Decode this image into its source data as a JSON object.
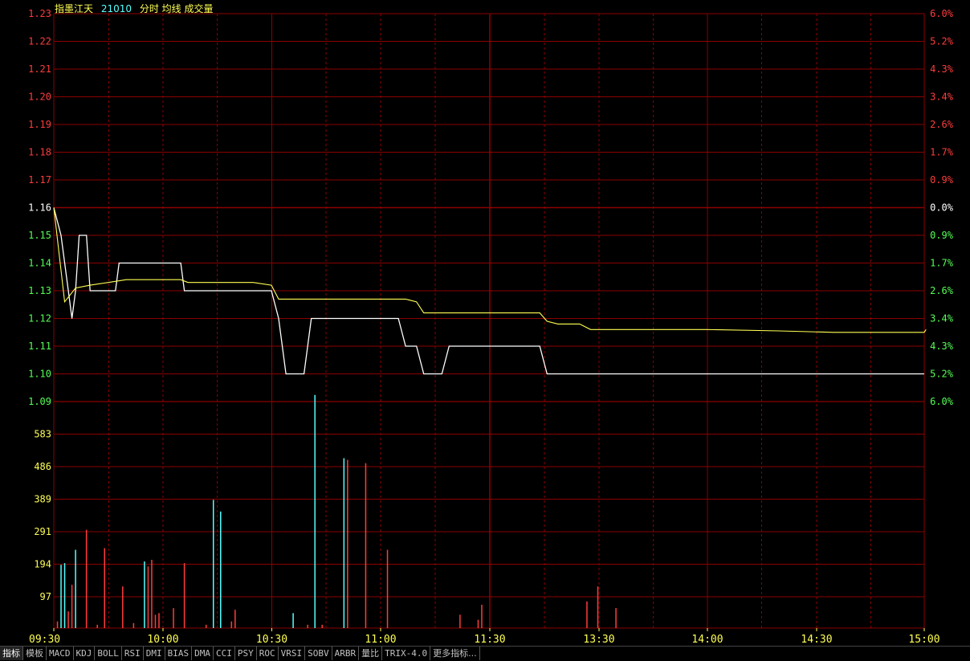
{
  "header": {
    "name": "指墨江天",
    "code": "21010",
    "legend": "分时 均线 成交量"
  },
  "colors": {
    "background": "#000000",
    "grid": "#8b0000",
    "axis_red": "#ff3c3c",
    "axis_green": "#54ff54",
    "axis_neutral": "#ffffff",
    "volume_axis": "#ffff54",
    "time_axis": "#ffff54",
    "price_line": "#ffffff",
    "avg_line": "#ffff54",
    "vol_up": "#ff3c3c",
    "vol_down": "#54ffff"
  },
  "chart_data": {
    "type": "line",
    "title": "指墨江天 21010",
    "x_ticks": [
      "09:30",
      "10:00",
      "10:30",
      "11:00",
      "11:30",
      "13:30",
      "14:00",
      "14:30",
      "15:00"
    ],
    "price_ticks": [
      "1.23",
      "1.22",
      "1.21",
      "1.20",
      "1.19",
      "1.18",
      "1.17",
      "1.16",
      "1.15",
      "1.14",
      "1.13",
      "1.12",
      "1.11",
      "1.10",
      "1.09"
    ],
    "pct_ticks": [
      "6.0%",
      "5.2%",
      "4.3%",
      "3.4%",
      "2.6%",
      "1.7%",
      "0.9%",
      "0.0%",
      "0.9%",
      "1.7%",
      "2.6%",
      "3.4%",
      "4.3%",
      "5.2%",
      "6.0%"
    ],
    "volume_ticks": [
      "583",
      "486",
      "389",
      "291",
      "194",
      "97"
    ],
    "price_range": [
      1.09,
      1.23
    ],
    "prev_close": 1.16,
    "volume_range": [
      0,
      680
    ],
    "minutes_total": 240,
    "series": [
      {
        "name": "分时",
        "points": [
          [
            0,
            1.16
          ],
          [
            2,
            1.15
          ],
          [
            4,
            1.13
          ],
          [
            5,
            1.12
          ],
          [
            6,
            1.13
          ],
          [
            7,
            1.15
          ],
          [
            9,
            1.15
          ],
          [
            10,
            1.13
          ],
          [
            17,
            1.13
          ],
          [
            18,
            1.14
          ],
          [
            35,
            1.14
          ],
          [
            36,
            1.13
          ],
          [
            60,
            1.13
          ],
          [
            62,
            1.12
          ],
          [
            64,
            1.1
          ],
          [
            69,
            1.1
          ],
          [
            71,
            1.12
          ],
          [
            95,
            1.12
          ],
          [
            97,
            1.11
          ],
          [
            100,
            1.11
          ],
          [
            102,
            1.1
          ],
          [
            107,
            1.1
          ],
          [
            109,
            1.11
          ],
          [
            134,
            1.11
          ],
          [
            136,
            1.1
          ],
          [
            240,
            1.1
          ]
        ]
      },
      {
        "name": "均线",
        "points": [
          [
            0,
            1.16
          ],
          [
            3,
            1.126
          ],
          [
            6,
            1.131
          ],
          [
            10,
            1.132
          ],
          [
            15,
            1.133
          ],
          [
            20,
            1.134
          ],
          [
            35,
            1.134
          ],
          [
            37,
            1.133
          ],
          [
            55,
            1.133
          ],
          [
            60,
            1.132
          ],
          [
            62,
            1.127
          ],
          [
            97,
            1.127
          ],
          [
            100,
            1.126
          ],
          [
            102,
            1.122
          ],
          [
            134,
            1.122
          ],
          [
            136,
            1.119
          ],
          [
            139,
            1.118
          ],
          [
            145,
            1.118
          ],
          [
            148,
            1.116
          ],
          [
            165,
            1.116
          ],
          [
            180,
            1.116
          ],
          [
            200,
            1.1155
          ],
          [
            215,
            1.115
          ],
          [
            240,
            1.115
          ],
          [
            240.5,
            1.116
          ]
        ]
      }
    ],
    "volume_bars": [
      [
        1,
        20,
        "up"
      ],
      [
        2,
        190,
        "down"
      ],
      [
        3,
        195,
        "down"
      ],
      [
        4,
        50,
        "up"
      ],
      [
        5,
        130,
        "up"
      ],
      [
        6,
        235,
        "down"
      ],
      [
        9,
        295,
        "up"
      ],
      [
        12,
        10,
        "up"
      ],
      [
        14,
        240,
        "up"
      ],
      [
        19,
        125,
        "up"
      ],
      [
        22,
        15,
        "up"
      ],
      [
        25,
        200,
        "down"
      ],
      [
        26,
        185,
        "up"
      ],
      [
        27,
        205,
        "up"
      ],
      [
        28,
        40,
        "up"
      ],
      [
        29,
        45,
        "up"
      ],
      [
        33,
        60,
        "up"
      ],
      [
        36,
        195,
        "up"
      ],
      [
        42,
        10,
        "up"
      ],
      [
        44,
        385,
        "down"
      ],
      [
        46,
        350,
        "down"
      ],
      [
        49,
        20,
        "up"
      ],
      [
        50,
        55,
        "up"
      ],
      [
        66,
        45,
        "down"
      ],
      [
        70,
        10,
        "up"
      ],
      [
        72,
        700,
        "down"
      ],
      [
        74,
        10,
        "up"
      ],
      [
        80,
        510,
        "down"
      ],
      [
        81,
        505,
        "up"
      ],
      [
        86,
        495,
        "up"
      ],
      [
        92,
        235,
        "up"
      ],
      [
        112,
        40,
        "up"
      ],
      [
        117,
        25,
        "up"
      ],
      [
        118,
        70,
        "up"
      ],
      [
        147,
        80,
        "up"
      ],
      [
        150,
        125,
        "up"
      ],
      [
        155,
        60,
        "up"
      ]
    ]
  },
  "tabs": [
    "指标",
    "模板",
    "MACD",
    "KDJ",
    "BOLL",
    "RSI",
    "DMI",
    "BIAS",
    "DMA",
    "CCI",
    "PSY",
    "ROC",
    "VRSI",
    "SOBV",
    "ARBR",
    "量比",
    "TRIX-4.0",
    "更多指标..."
  ]
}
